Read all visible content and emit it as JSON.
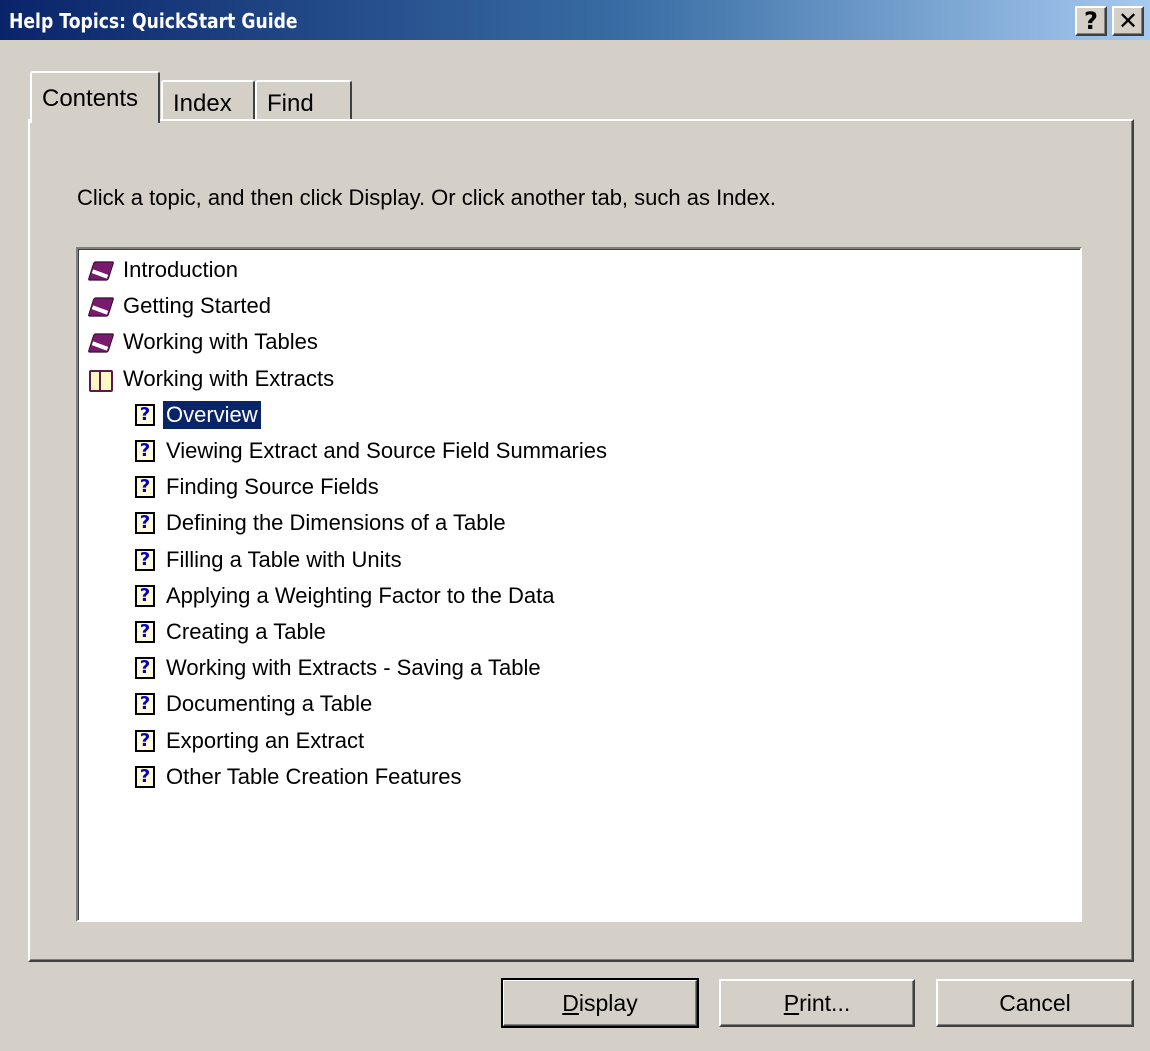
{
  "window": {
    "title": "Help Topics: QuickStart Guide",
    "help_button": "?",
    "close_button": "✕"
  },
  "tabs": [
    {
      "label": "Contents",
      "selected": true
    },
    {
      "label": "Index",
      "selected": false
    },
    {
      "label": "Find",
      "selected": false
    }
  ],
  "instruction": "Click a topic, and then click Display. Or click another tab, such as Index.",
  "tree": {
    "items": [
      {
        "label": "Introduction",
        "icon": "book-closed-icon",
        "level": 0
      },
      {
        "label": "Getting Started",
        "icon": "book-closed-icon",
        "level": 0
      },
      {
        "label": "Working with Tables",
        "icon": "book-closed-icon",
        "level": 0
      },
      {
        "label": "Working with Extracts",
        "icon": "book-open-icon",
        "level": 0
      },
      {
        "label": "Overview",
        "icon": "help-page-icon",
        "level": 1,
        "selected": true
      },
      {
        "label": "Viewing Extract and Source Field Summaries",
        "icon": "help-page-icon",
        "level": 1
      },
      {
        "label": "Finding Source Fields",
        "icon": "help-page-icon",
        "level": 1
      },
      {
        "label": "Defining the Dimensions of a Table",
        "icon": "help-page-icon",
        "level": 1
      },
      {
        "label": "Filling a Table with Units",
        "icon": "help-page-icon",
        "level": 1
      },
      {
        "label": "Applying a Weighting Factor to the Data",
        "icon": "help-page-icon",
        "level": 1
      },
      {
        "label": "Creating a Table",
        "icon": "help-page-icon",
        "level": 1
      },
      {
        "label": "Working with Extracts - Saving a Table",
        "icon": "help-page-icon",
        "level": 1
      },
      {
        "label": "Documenting a Table",
        "icon": "help-page-icon",
        "level": 1
      },
      {
        "label": "Exporting an Extract",
        "icon": "help-page-icon",
        "level": 1
      },
      {
        "label": "Other Table Creation Features",
        "icon": "help-page-icon",
        "level": 1
      }
    ]
  },
  "buttons": {
    "display": {
      "mnemonic": "D",
      "rest": "isplay"
    },
    "print": {
      "mnemonic": "P",
      "rest": "rint..."
    },
    "cancel": "Cancel"
  }
}
